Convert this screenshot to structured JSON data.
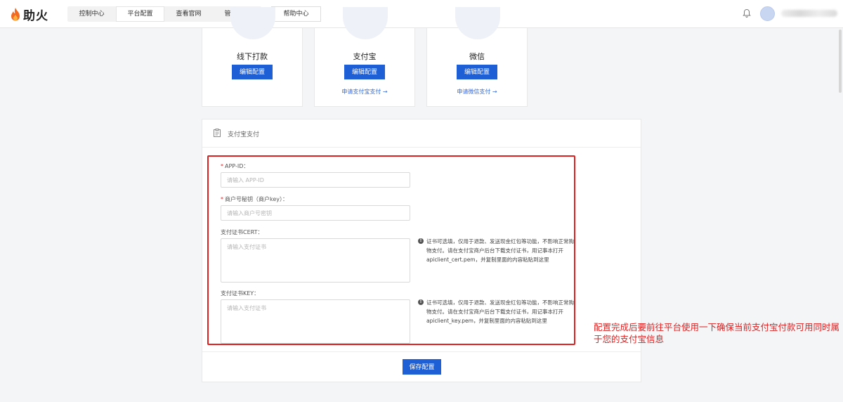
{
  "header": {
    "logo_text": "助火",
    "nav": [
      {
        "label": "控制中心"
      },
      {
        "label": "平台配置"
      },
      {
        "label": "查看官网"
      },
      {
        "label": "管理后台"
      }
    ],
    "help_label": "帮助中心"
  },
  "payment_methods": [
    {
      "title": "线下打款",
      "button": "编辑配置",
      "link": ""
    },
    {
      "title": "支付宝",
      "button": "编辑配置",
      "link": "申请支付宝支付 →"
    },
    {
      "title": "微信",
      "button": "编辑配置",
      "link": "申请微信支付 →"
    }
  ],
  "form": {
    "title": "支付宝支付",
    "app_id": {
      "required_mark": "*",
      "label": "APP-ID：",
      "placeholder": "请输入 APP-ID"
    },
    "merchant_key": {
      "required_mark": "*",
      "label": "商户号秘钥（商户key）：",
      "placeholder": "请输入商户号密钥"
    },
    "cert": {
      "label": "支付证书CERT：",
      "placeholder": "请输入支付证书",
      "hint": "证书可选填，仅用于退款、发送现金红包等功能，不影响正常购物支付。请在支付宝商户后台下载支付证书，用记事本打开apiclient_cert.pem，并复制里面的内容粘贴到这里"
    },
    "key": {
      "label": "支付证书KEY：",
      "placeholder": "请输入支付证书",
      "hint": "证书可选填，仅用于退款、发送现金红包等功能，不影响正常购物支付。请在支付宝商户后台下载支付证书，用记事本打开apiclient_key.pem，并复制里面的内容粘贴到这里"
    },
    "save_label": "保存配置"
  },
  "annotation": "配置完成后要前往平台使用一下确保当前支付宝付款可用同时属于您的支付宝信息",
  "colors": {
    "primary": "#1f5fd6",
    "highlight": "#e02020",
    "link": "#3a6bd6"
  },
  "icons": [
    "flame-logo-icon",
    "bell-icon",
    "clipboard-icon",
    "info-icon"
  ]
}
